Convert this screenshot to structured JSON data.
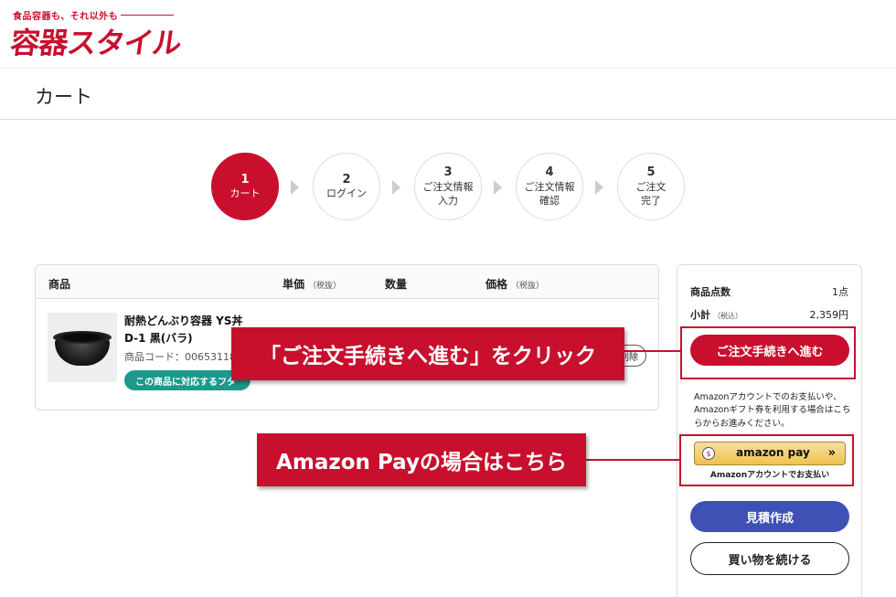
{
  "header": {
    "tagline": "食品容器も、それ以外も",
    "logo": "容器スタイル"
  },
  "page": {
    "title": "カート"
  },
  "steps": [
    {
      "num": "1",
      "label": "カート",
      "active": true
    },
    {
      "num": "2",
      "label": "ログイン",
      "active": false
    },
    {
      "num": "3",
      "label": "ご注文情報入力",
      "line1": "ご注文情報",
      "line2": "入力",
      "active": false
    },
    {
      "num": "4",
      "label": "ご注文情報確認",
      "line1": "ご注文情報",
      "line2": "確認",
      "active": false
    },
    {
      "num": "5",
      "label": "ご注文完了",
      "line1": "ご注文",
      "line2": "完了",
      "active": false
    }
  ],
  "cart": {
    "columns": {
      "product": "商品",
      "unit_price": "単価",
      "unit_price_note": "（税抜）",
      "quantity": "数量",
      "price": "価格",
      "price_note": "（税抜）"
    },
    "items": [
      {
        "name": "耐熱どんぶり容器 YS丼 D-1 黒(バラ)",
        "code": "商品コード：00653118",
        "compat_button": "この商品に対応するフタ",
        "delete_button": "削除"
      }
    ]
  },
  "summary": {
    "count_label": "商品点数",
    "count_value": "1点",
    "subtotal_label": "小計",
    "subtotal_note": "（税込）",
    "subtotal_value": "2,359円",
    "checkout_button": "ご注文手続きへ進む",
    "amazon_note": "Amazonアカウントでのお支払いや、Amazonギフト券を利用する場合はこちらからお進みください。",
    "amazon_pay_logo": "amazon pay",
    "amazon_pay_chevron": "»",
    "amazon_caption": "Amazonアカウントでお支払い",
    "estimate_button": "見積作成",
    "continue_button": "買い物を続ける"
  },
  "annotations": {
    "checkout_callout": "「ご注文手続きへ進む」をクリック",
    "amazon_callout": "Amazon Payの場合はこちら"
  },
  "colors": {
    "brand_red": "#c8102e",
    "teal": "#1b9a8c",
    "indigo": "#3f51b5",
    "amazon_gold": "#f0c14b"
  }
}
